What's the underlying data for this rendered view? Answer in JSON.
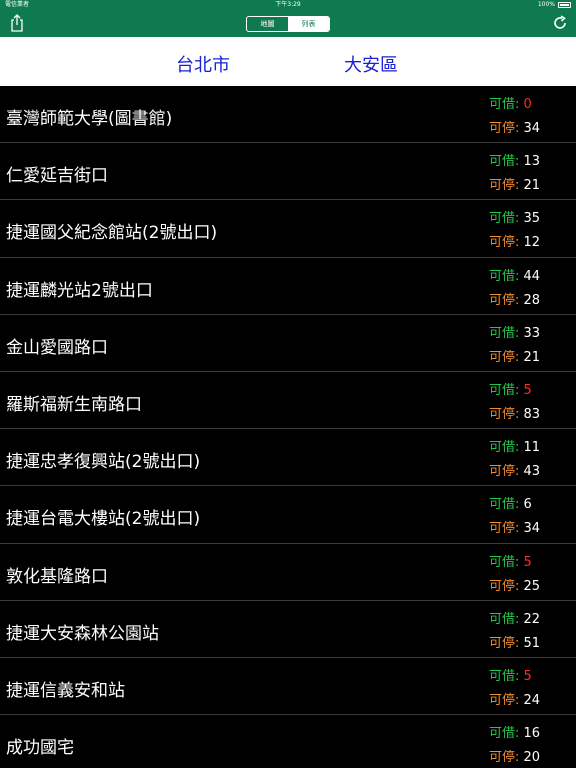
{
  "status_bar": {
    "carrier": "電信業者",
    "time": "下午3:29",
    "battery": "100%"
  },
  "nav": {
    "segments": [
      "地圖",
      "列表"
    ],
    "active_segment": 1
  },
  "header": {
    "city": "台北市",
    "district": "大安區"
  },
  "labels": {
    "borrow": "可借:",
    "park": "可停:"
  },
  "colors": {
    "nav_green": "#0f7a4f",
    "header_blue": "#1a20d6",
    "borrow_label": "#27c44a",
    "park_label": "#f08a2c",
    "low_value": "#ff2b2b"
  },
  "stations": [
    {
      "name": "臺灣師範大學(圖書館)",
      "borrow": "0",
      "park": "34",
      "low": true
    },
    {
      "name": "仁愛延吉街口",
      "borrow": "13",
      "park": "21",
      "low": false
    },
    {
      "name": "捷運國父紀念館站(2號出口)",
      "borrow": "35",
      "park": "12",
      "low": false
    },
    {
      "name": "捷運麟光站2號出口",
      "borrow": "44",
      "park": "28",
      "low": false
    },
    {
      "name": "金山愛國路口",
      "borrow": "33",
      "park": "21",
      "low": false
    },
    {
      "name": "羅斯福新生南路口",
      "borrow": "5",
      "park": "83",
      "low": true
    },
    {
      "name": "捷運忠孝復興站(2號出口)",
      "borrow": "11",
      "park": "43",
      "low": false
    },
    {
      "name": "捷運台電大樓站(2號出口)",
      "borrow": "6",
      "park": "34",
      "low": false
    },
    {
      "name": "敦化基隆路口",
      "borrow": "5",
      "park": "25",
      "low": true
    },
    {
      "name": "捷運大安森林公園站",
      "borrow": "22",
      "park": "51",
      "low": false
    },
    {
      "name": "捷運信義安和站",
      "borrow": "5",
      "park": "24",
      "low": true
    },
    {
      "name": "成功國宅",
      "borrow": "16",
      "park": "20",
      "low": false
    }
  ]
}
